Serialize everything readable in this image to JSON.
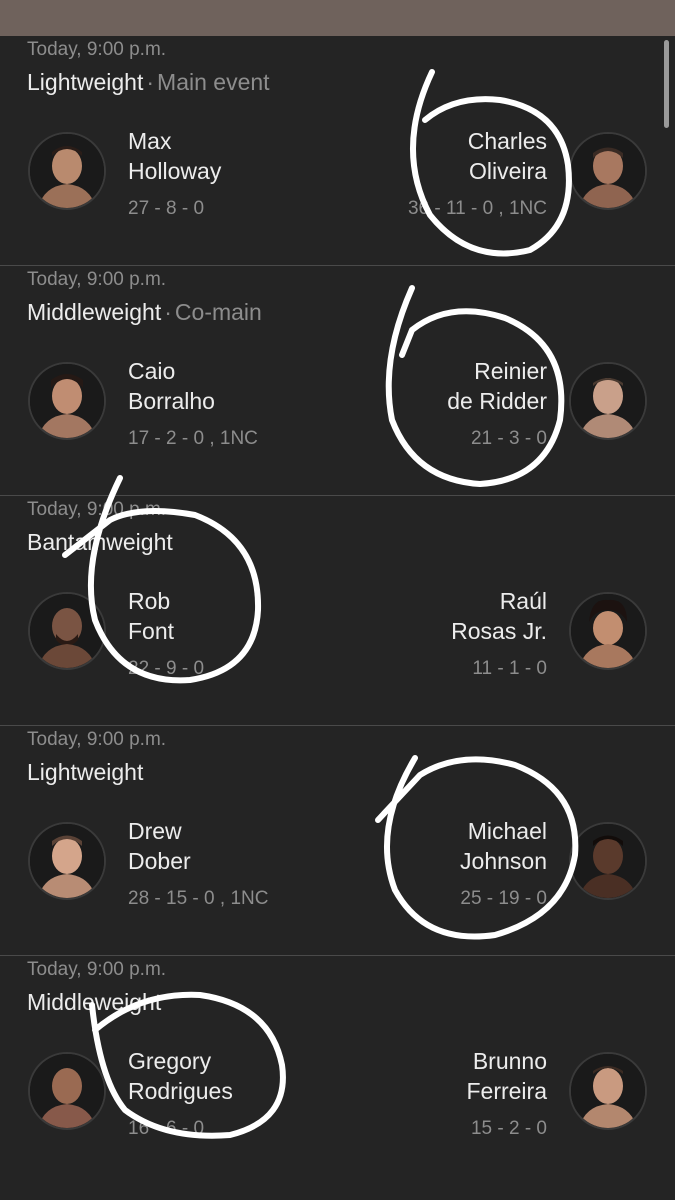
{
  "fights": [
    {
      "time": "Today, 9:00 p.m.",
      "weight": "Lightweight",
      "tag": "Main event",
      "red": {
        "first": "Max",
        "last": "Holloway",
        "record": "27 - 8 - 0"
      },
      "blue": {
        "first": "Charles",
        "last": "Oliveira",
        "record": "36 - 11 - 0 , 1NC"
      }
    },
    {
      "time": "Today, 9:00 p.m.",
      "weight": "Middleweight",
      "tag": "Co-main",
      "red": {
        "first": "Caio",
        "last": "Borralho",
        "record": "17 - 2 - 0 , 1NC"
      },
      "blue": {
        "first": "Reinier",
        "last": "de Ridder",
        "record": "21 - 3 - 0"
      }
    },
    {
      "time": "Today, 9:00 p.m.",
      "weight": "Bantamweight",
      "tag": "",
      "red": {
        "first": "Rob",
        "last": "Font",
        "record": "22 - 9 - 0"
      },
      "blue": {
        "first": "Raúl",
        "last": "Rosas Jr.",
        "record": "11 - 1 - 0"
      }
    },
    {
      "time": "Today, 9:00 p.m.",
      "weight": "Lightweight",
      "tag": "",
      "red": {
        "first": "Drew",
        "last": "Dober",
        "record": "28 - 15 - 0 , 1NC"
      },
      "blue": {
        "first": "Michael",
        "last": "Johnson",
        "record": "25 - 19 - 0"
      }
    },
    {
      "time": "Today, 9:00 p.m.",
      "weight": "Middleweight",
      "tag": "",
      "red": {
        "first": "Gregory",
        "last": "Rodrigues",
        "record": "16 - 6 - 0"
      },
      "blue": {
        "first": "Brunno",
        "last": "Ferreira",
        "record": "15 - 2 - 0"
      }
    }
  ],
  "colors": {
    "background": "#242424",
    "secondary_text": "#8d8d8d",
    "annotation": "#ffffff"
  },
  "icons": [
    "fighter-avatar-icon"
  ]
}
